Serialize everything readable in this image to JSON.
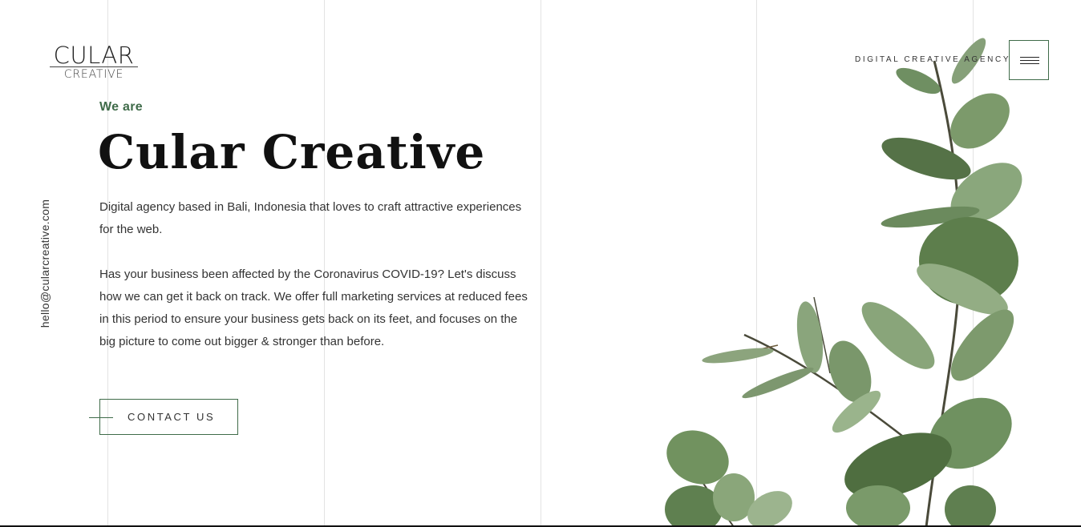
{
  "brand": {
    "logo_main": "CULAR",
    "logo_sub": "CREATIVE",
    "tagline": "DIGITAL CREATIVE AGENCY"
  },
  "header": {
    "menu_icon": "hamburger-menu-icon"
  },
  "sidebar": {
    "email": "hello@cularcreative.com"
  },
  "hero": {
    "kicker": "We are",
    "title": "Cular Creative",
    "paragraph_1": "Digital agency based in Bali, Indonesia that loves to craft attractive experiences for the web.",
    "paragraph_2": "Has your business been affected by the Coronavirus COVID-19? Let's discuss how we can get it back on track. We offer full marketing services at reduced fees in this period to ensure your business gets back on its feet, and focuses on the big picture to come out bigger & stronger than before.",
    "cta_label": "CONTACT US"
  },
  "colors": {
    "accent": "#3f6b49",
    "text": "#333333",
    "heading": "#111111",
    "gridline": "#e3e3e3"
  }
}
